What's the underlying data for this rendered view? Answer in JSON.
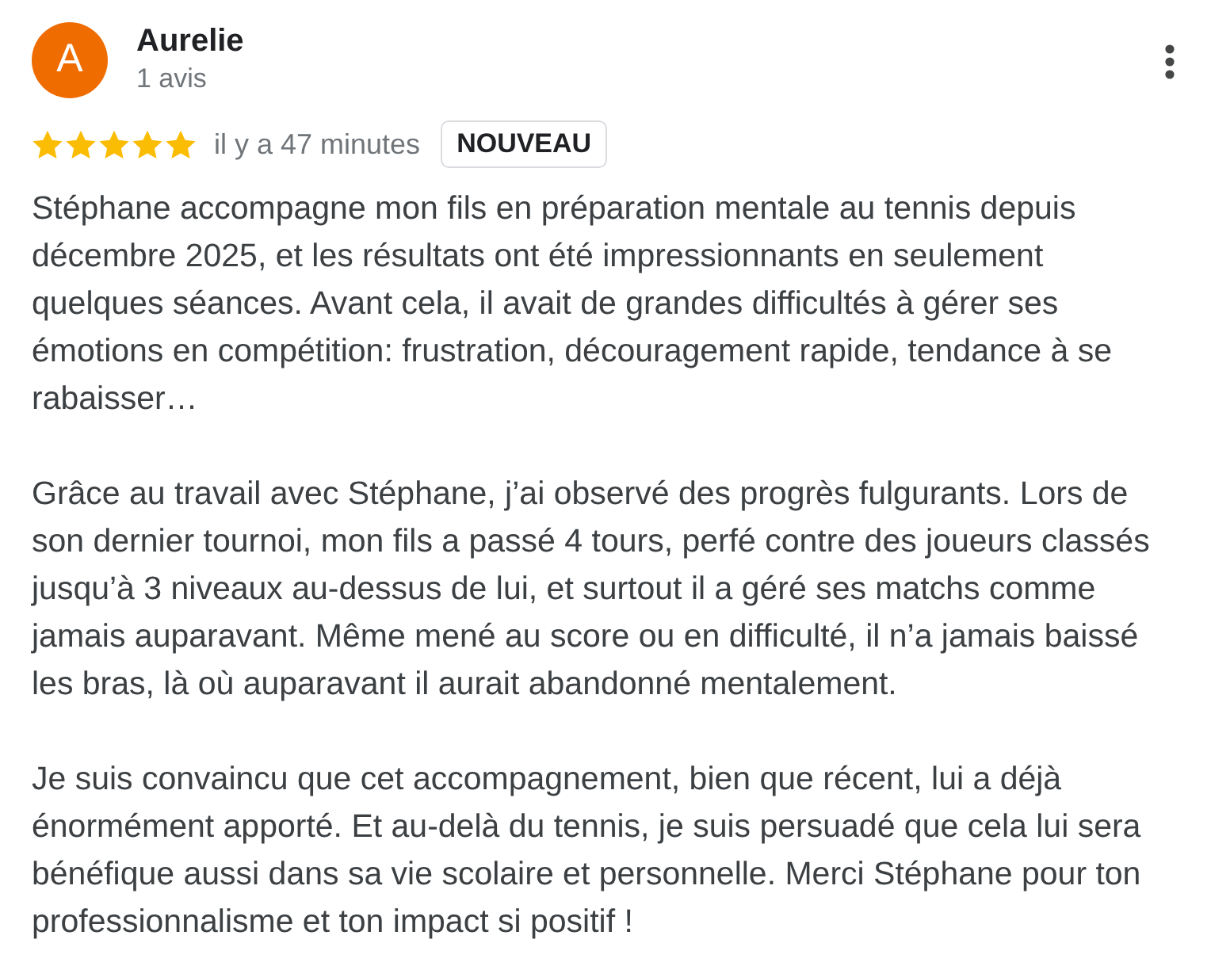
{
  "reviewer": {
    "initial": "A",
    "name": "Aurelie",
    "review_count": "1 avis"
  },
  "review": {
    "stars": 5,
    "time": "il y a 47 minutes",
    "badge": "NOUVEAU",
    "paragraphs": [
      "Stéphane accompagne mon fils en préparation mentale au tennis depuis décembre 2025, et les résultats ont été impressionnants en seulement quelques séances. Avant cela, il avait de grandes difficultés à gérer ses émotions en compétition: frustration, découragement rapide, tendance à se rabaisser…",
      "Grâce au travail avec Stéphane, j’ai observé des progrès fulgurants. Lors de son dernier tournoi, mon fils a passé 4 tours, perfé contre des joueurs classés jusqu’à 3 niveaux au-dessus de lui, et surtout il a géré ses matchs comme jamais auparavant. Même mené au score ou en difficulté, il n’a jamais baissé les bras, là où auparavant il aurait abandonné mentalement.",
      "Je suis convaincu que cet accompagnement, bien que récent, lui a déjà énormément apporté. Et au-delà du tennis, je suis persuadé que cela lui sera bénéfique aussi dans sa vie scolaire et personnelle. Merci Stéphane pour ton professionnalisme et ton impact si positif !"
    ]
  }
}
